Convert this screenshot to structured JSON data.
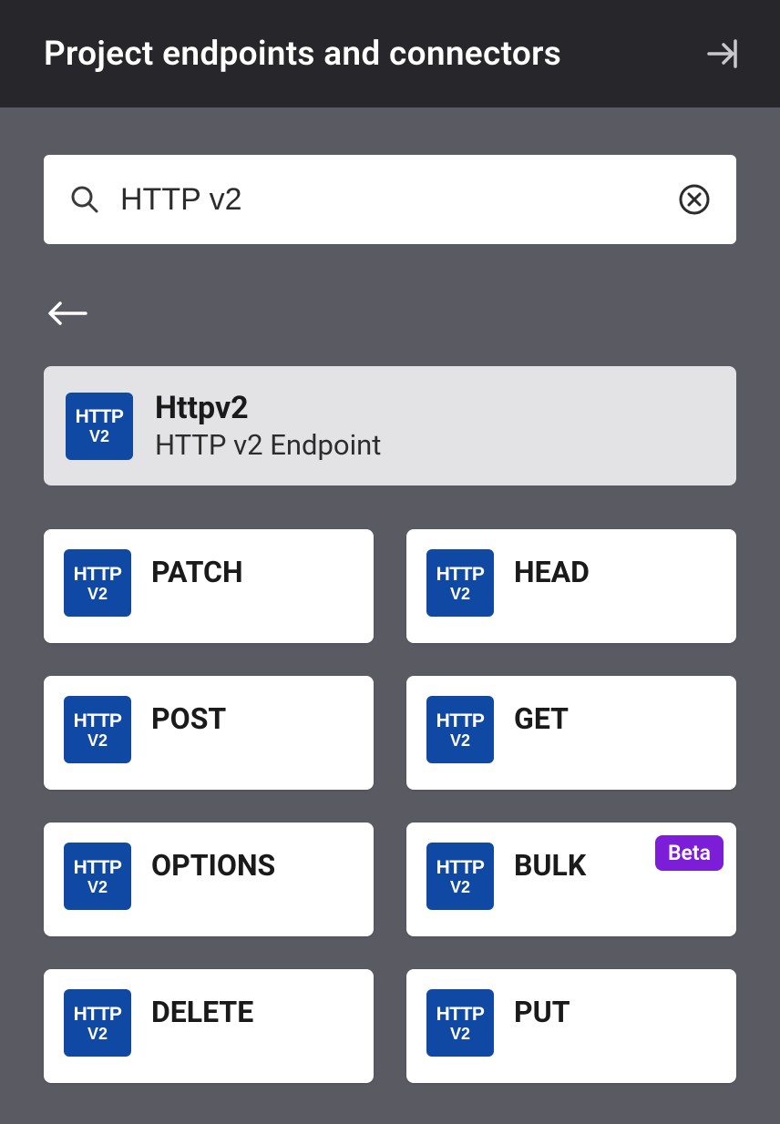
{
  "header": {
    "title": "Project endpoints and connectors"
  },
  "search": {
    "value": "HTTP v2"
  },
  "icon": {
    "line1": "HTTP",
    "line2": "V2"
  },
  "main_card": {
    "title": "Httpv2",
    "subtitle": "HTTP v2 Endpoint"
  },
  "methods": [
    {
      "label": "PATCH",
      "badge": null
    },
    {
      "label": "HEAD",
      "badge": null
    },
    {
      "label": "POST",
      "badge": null
    },
    {
      "label": "GET",
      "badge": null
    },
    {
      "label": "OPTIONS",
      "badge": null
    },
    {
      "label": "BULK",
      "badge": "Beta"
    },
    {
      "label": "DELETE",
      "badge": null
    },
    {
      "label": "PUT",
      "badge": null
    }
  ]
}
